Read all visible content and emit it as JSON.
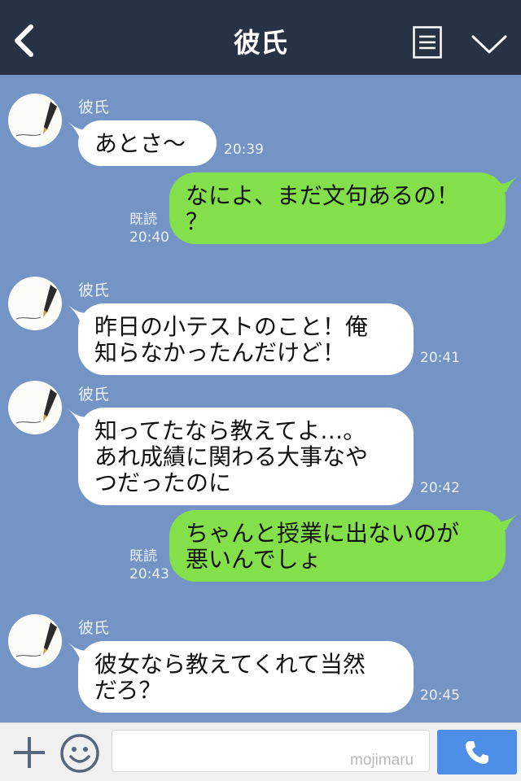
{
  "header": {
    "title": "彼氏",
    "back_icon": "chevron-left-icon",
    "menu_icon": "document-list-icon",
    "collapse_icon": "chevron-down-icon"
  },
  "messages": [
    {
      "side": "in",
      "sender": "彼氏",
      "text": "あとさ〜",
      "time": "20:39"
    },
    {
      "side": "out",
      "read": "既読",
      "text": "なによ、まだ文句あるの！\n？",
      "time": "20:40"
    },
    {
      "side": "in",
      "sender": "彼氏",
      "text": "昨日の小テストのこと！俺\n知らなかったんだけど！",
      "time": "20:41"
    },
    {
      "side": "in",
      "sender": "彼氏",
      "text": "知ってたなら教えてよ…。\nあれ成績に関わる大事なや\nつだったのに",
      "time": "20:42"
    },
    {
      "side": "out",
      "read": "既読",
      "text": "ちゃんと授業に出ないのが\n悪いんでしょ",
      "time": "20:43"
    },
    {
      "side": "in",
      "sender": "彼氏",
      "text": "彼女なら教えてくれて当然\nだろ？",
      "time": "20:45"
    }
  ],
  "input_bar": {
    "message_value": "",
    "watermark": "mojimaru",
    "plus_icon": "plus-icon",
    "emoji_icon": "smiley-icon",
    "call_icon": "phone-icon"
  },
  "colors": {
    "header_bg": "#273245",
    "chat_bg": "#7394c4",
    "incoming_bubble": "#ffffff",
    "outgoing_bubble": "#84e04a",
    "call_button": "#4d8ee8"
  }
}
